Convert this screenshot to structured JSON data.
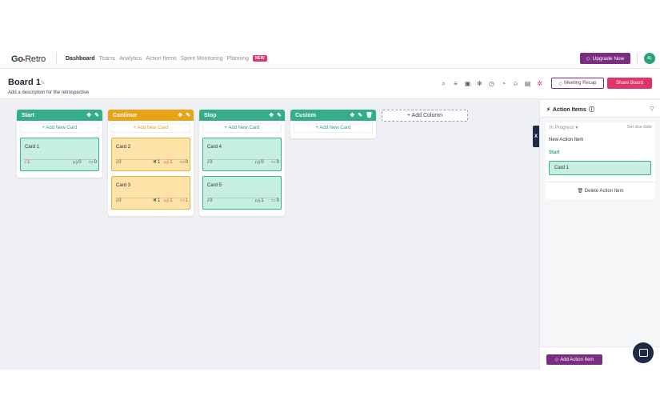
{
  "nav": {
    "logo_go": "Go",
    "logo_accent": "▪",
    "logo_retro": "Retro",
    "items": [
      "Dashboard",
      "Teams",
      "Analytics",
      "Action Items",
      "Sprint Monitoring",
      "Planning"
    ],
    "new_badge": "NEW",
    "upgrade_label": "Upgrade Now",
    "avatar_initials": "AL"
  },
  "board": {
    "title": "Board 1",
    "description": "Add a description for the retrospective",
    "meeting_recap_label": "Meeting Recap",
    "share_label": "Share Board",
    "add_column_label": "+ Add Column"
  },
  "columns": [
    {
      "name": "Start",
      "color": "#36ad8a",
      "add_card_label": "+ Add New Card",
      "cards": [
        {
          "title": "Card 1",
          "votes": "1",
          "likes": "0",
          "comments": "0"
        }
      ]
    },
    {
      "name": "Continue",
      "color": "#e8a317",
      "add_card_label": "+ Add New Card",
      "cards": [
        {
          "title": "Card 2",
          "votes": "0",
          "x": "1",
          "likes": "1",
          "comments": "0"
        },
        {
          "title": "Card 3",
          "votes": "0",
          "x": "1",
          "likes": "1",
          "comments": "1"
        }
      ]
    },
    {
      "name": "Stop",
      "color": "#36ad8a",
      "add_card_label": "+ Add New Card",
      "cards": [
        {
          "title": "Card 4",
          "votes": "0",
          "likes": "0",
          "comments": "0"
        },
        {
          "title": "Card 5",
          "votes": "0",
          "likes": "1",
          "comments": "0"
        }
      ]
    },
    {
      "name": "Custom",
      "color": "#36ad8a",
      "add_card_label": "+ Add New Card",
      "cards": []
    }
  ],
  "panel": {
    "tab_label": "X",
    "title": "Action Items",
    "status": "In Progress",
    "due_label": "Set due date",
    "item_name": "New Action Item",
    "item_column": "Start",
    "item_card": "Card 1",
    "delete_label": "Delete Action Item",
    "add_label": "Add Action Item"
  }
}
